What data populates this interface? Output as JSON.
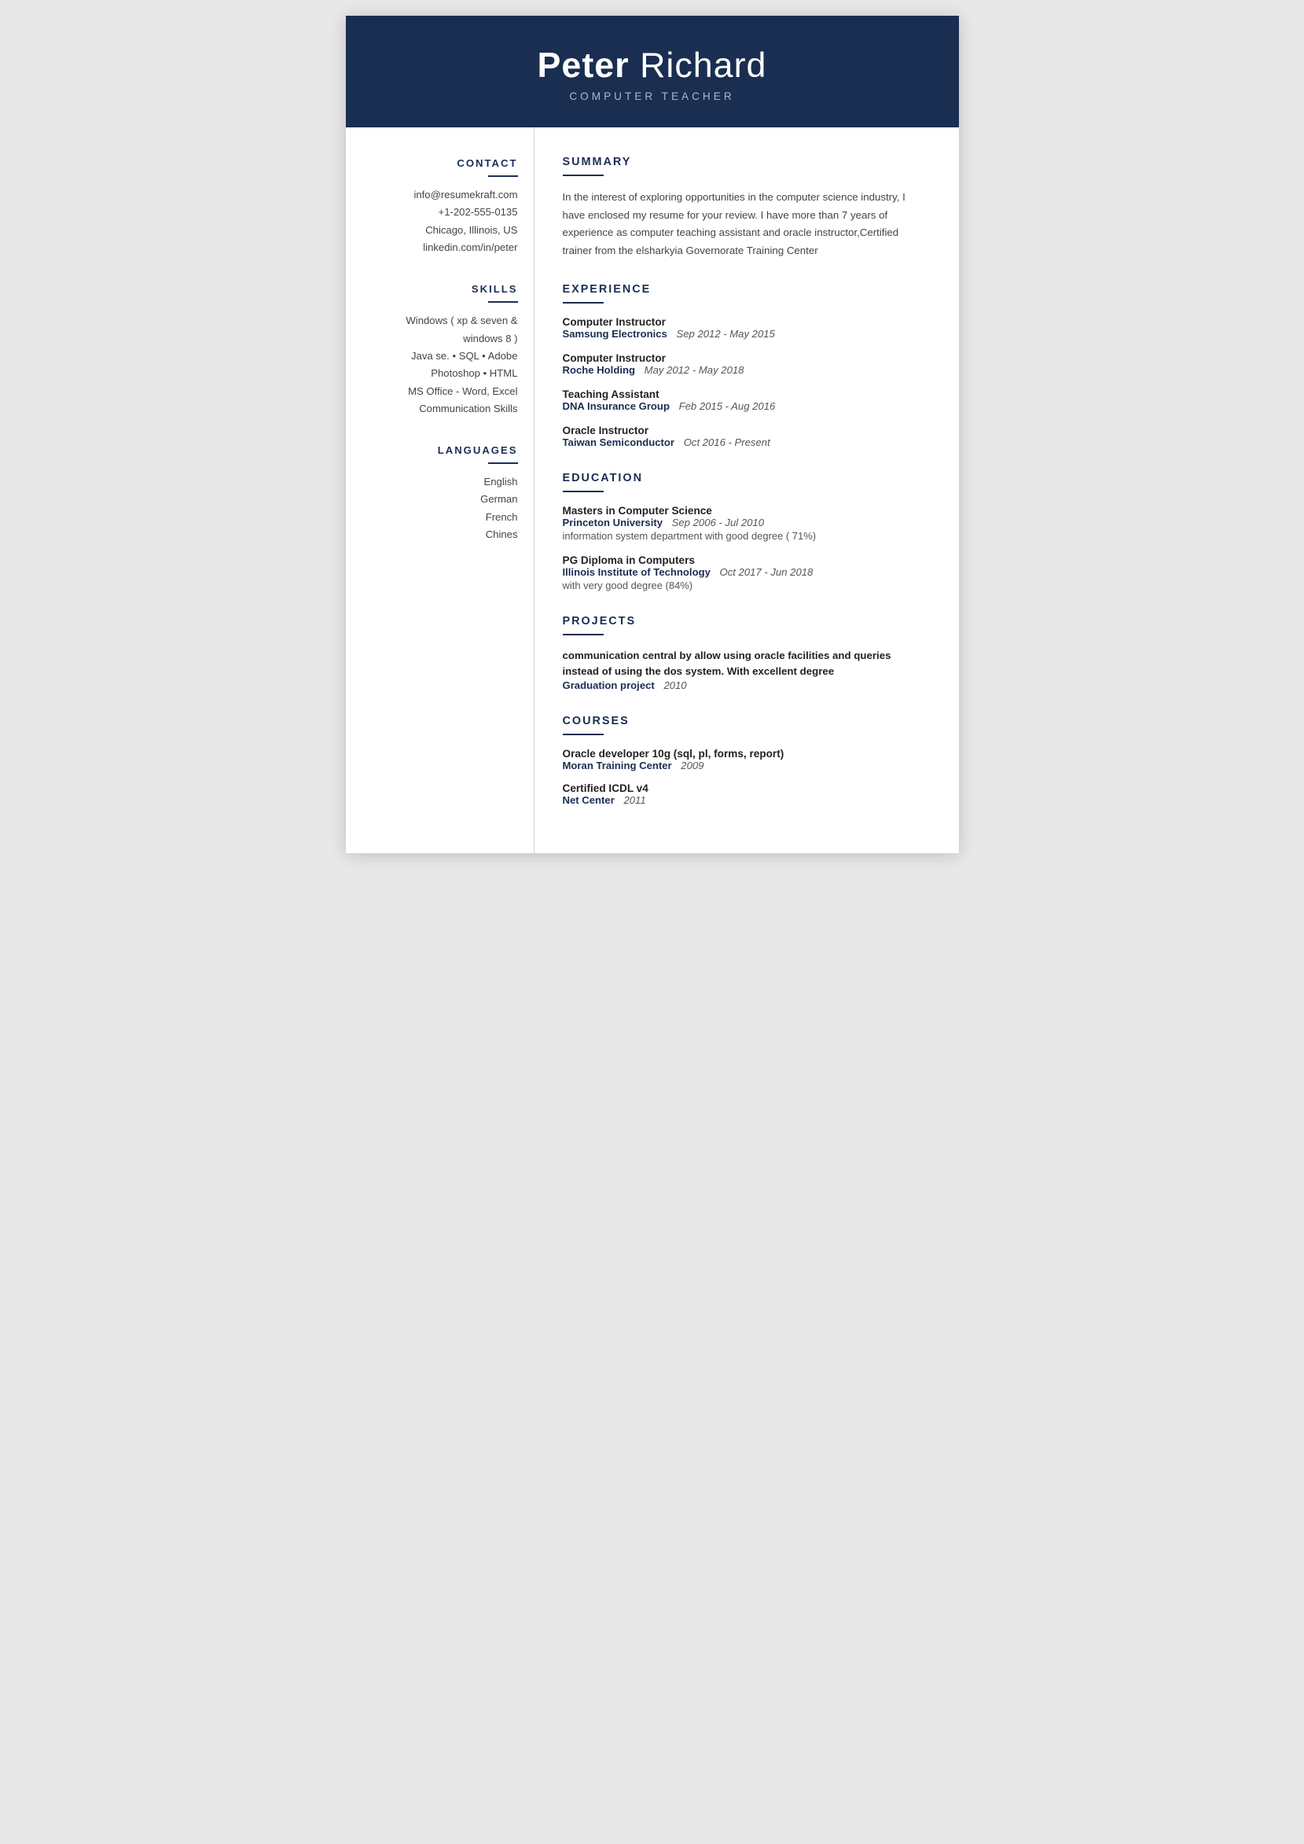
{
  "header": {
    "first_name": "Peter",
    "last_name": "Richard",
    "title": "COMPUTER TEACHER"
  },
  "sidebar": {
    "contact": {
      "section_title": "CONTACT",
      "email": "info@resumekraft.com",
      "phone": "+1-202-555-0135",
      "location": "Chicago, Illinois, US",
      "linkedin": "linkedin.com/in/peter"
    },
    "skills": {
      "section_title": "SKILLS",
      "items": [
        "Windows ( xp & seven & windows 8 )",
        "Java se. • SQL • Adobe Photoshop • HTML",
        "MS Office - Word, Excel",
        "Communication Skills"
      ]
    },
    "languages": {
      "section_title": "LANGUAGES",
      "items": [
        "English",
        "German",
        "French",
        "Chines"
      ]
    }
  },
  "main": {
    "summary": {
      "section_title": "SUMMARY",
      "text": "In the interest of exploring opportunities in the computer science industry, I have enclosed my resume for your review. I have more than 7 years of experience as computer teaching assistant and oracle instructor,Certified trainer from the elsharkyia Governorate Training Center"
    },
    "experience": {
      "section_title": "EXPERIENCE",
      "items": [
        {
          "role": "Computer Instructor",
          "company": "Samsung Electronics",
          "dates": "Sep 2012 - May 2015"
        },
        {
          "role": "Computer Instructor",
          "company": "Roche Holding",
          "dates": "May 2012 - May 2018"
        },
        {
          "role": "Teaching Assistant",
          "company": "DNA Insurance Group",
          "dates": "Feb 2015 - Aug 2016"
        },
        {
          "role": "Oracle Instructor",
          "company": "Taiwan Semiconductor",
          "dates": "Oct 2016 - Present"
        }
      ]
    },
    "education": {
      "section_title": "EDUCATION",
      "items": [
        {
          "degree": "Masters in Computer Science",
          "institution": "Princeton University",
          "dates": "Sep 2006 - Jul 2010",
          "detail": "information system department with good degree ( 71%)"
        },
        {
          "degree": "PG Diploma in Computers",
          "institution": "Illinois Institute of Technology",
          "dates": "Oct 2017 - Jun 2018",
          "detail": "with very good degree (84%)"
        }
      ]
    },
    "projects": {
      "section_title": "PROJECTS",
      "items": [
        {
          "description": "communication central by allow using oracle facilities and queries instead of using the dos system. With excellent degree",
          "name": "Graduation project",
          "year": "2010"
        }
      ]
    },
    "courses": {
      "section_title": "COURSES",
      "items": [
        {
          "name": "Oracle developer 10g (sql, pl, forms, report)",
          "center": "Moran Training Center",
          "year": "2009"
        },
        {
          "name": "Certified ICDL v4",
          "center": "Net Center",
          "year": "2011"
        }
      ]
    }
  }
}
